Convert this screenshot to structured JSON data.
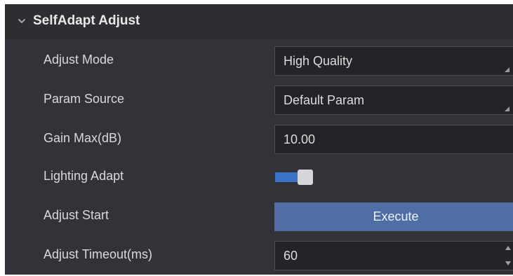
{
  "group": {
    "title": "SelfAdapt Adjust",
    "expanded_icon": "chevron-down-icon"
  },
  "rows": {
    "adjust_mode": {
      "label": "Adjust Mode",
      "value": "High Quality"
    },
    "param_source": {
      "label": "Param Source",
      "value": "Default Param"
    },
    "gain_max": {
      "label": "Gain Max(dB)",
      "value": "10.00"
    },
    "lighting_adapt": {
      "label": "Lighting Adapt",
      "enabled": true
    },
    "adjust_start": {
      "label": "Adjust Start",
      "button_label": "Execute"
    },
    "adjust_timeout": {
      "label": "Adjust Timeout(ms)",
      "value": "60"
    }
  },
  "colors": {
    "panel_bg": "#313338",
    "toggle_on": "#3a74c9",
    "button_bg": "#4e6ea5"
  }
}
